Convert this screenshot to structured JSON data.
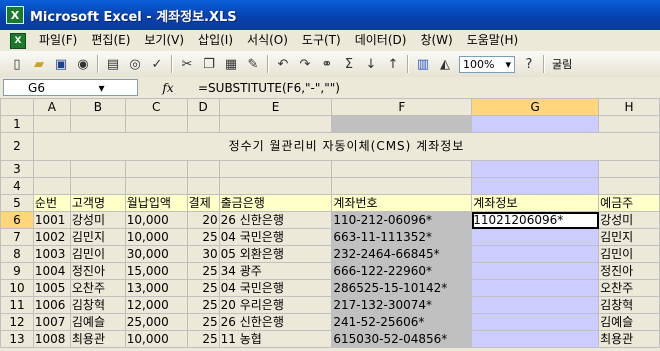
{
  "window": {
    "title": "Microsoft Excel - 계좌정보.XLS"
  },
  "menu": {
    "items": [
      "파일(F)",
      "편집(E)",
      "보기(V)",
      "삽입(I)",
      "서식(O)",
      "도구(T)",
      "데이터(D)",
      "창(W)",
      "도움말(H)"
    ]
  },
  "toolbar": {
    "zoom": "100%",
    "font_label": "굴림"
  },
  "formula_bar": {
    "name_box": "G6",
    "fx": "fx",
    "formula": "=SUBSTITUTE(F6,\"-\",\"\")"
  },
  "sheet": {
    "columns": [
      "A",
      "B",
      "C",
      "D",
      "E",
      "F",
      "G",
      "H"
    ],
    "rows": [
      "1",
      "2",
      "3",
      "4",
      "5",
      "6",
      "7",
      "8",
      "9",
      "10",
      "11",
      "12",
      "13"
    ],
    "title": "정수기 월관리비 자동이체(CMS) 계좌정보",
    "headers": [
      "순번",
      "고객명",
      "월납입액",
      "결제",
      "출금은행",
      "계좌번호",
      "계좌정보",
      "예금주"
    ],
    "data": [
      [
        "1001",
        "강성미",
        "10,000",
        "20",
        "26 신한은행",
        "110-212-06096*",
        "11021206096*",
        "강성미"
      ],
      [
        "1002",
        "김민지",
        "10,000",
        "25",
        "04 국민은행",
        "663-11-111352*",
        "",
        "김민지"
      ],
      [
        "1003",
        "김민이",
        "30,000",
        "30",
        "05 외환은행",
        "232-2464-66845*",
        "",
        "김민이"
      ],
      [
        "1004",
        "정진아",
        "15,000",
        "25",
        "34 광주",
        "666-122-22960*",
        "",
        "정진아"
      ],
      [
        "1005",
        "오찬주",
        "13,000",
        "25",
        "04 국민은행",
        "286525-15-10142*",
        "",
        "오찬주"
      ],
      [
        "1006",
        "김창혁",
        "12,000",
        "25",
        "20 우리은행",
        "217-132-30074*",
        "",
        "김창혁"
      ],
      [
        "1007",
        "김예슬",
        "25,000",
        "25",
        "26 신한은행",
        "241-52-25606*",
        "",
        "김예슬"
      ],
      [
        "1008",
        "최용관",
        "10,000",
        "25",
        "11 농협",
        "615030-52-04856*",
        "",
        "최용관"
      ]
    ]
  }
}
